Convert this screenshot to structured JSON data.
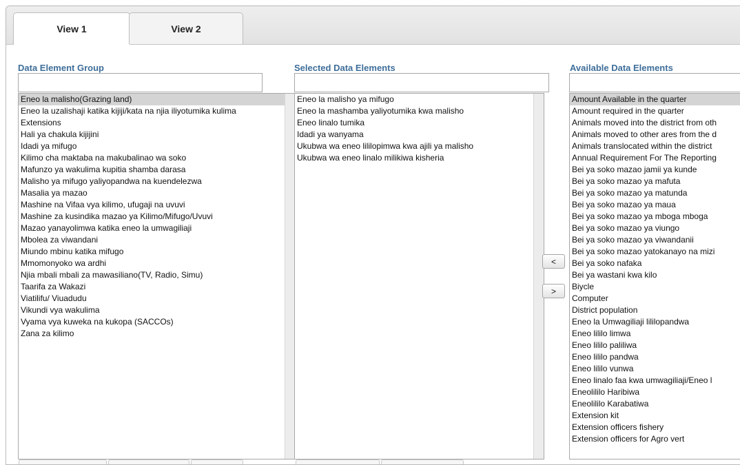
{
  "tabs": [
    {
      "label": "View 1",
      "active": true
    },
    {
      "label": "View 2",
      "active": false
    }
  ],
  "group": {
    "heading": "Data Element Group",
    "filter_value": "",
    "items": [
      "Eneo la malisho(Grazing land)",
      "Eneo la uzalishaji katika kijiji/kata na njia iliyotumika kulima",
      "Extensions",
      "Hali ya chakula kijijini",
      "Idadi ya mifugo",
      "Kilimo cha maktaba na makubalinao wa soko",
      "Mafunzo ya wakulima kupitia shamba darasa",
      "Malisho ya mifugo yaliyopandwa na kuendelezwa",
      "Masalia ya mazao",
      "Mashine na Vifaa vya kilimo, ufugaji na uvuvi",
      "Mashine za kusindika mazao ya Kilimo/Mifugo/Uvuvi",
      "Mazao yanayolimwa katika eneo la umwagiliaji",
      "Mbolea za viwandani",
      "Miundo mbinu katika mifugo",
      "Mmomonyoko wa ardhi",
      "Njia mbali mbali za mawasiliano(TV, Radio, Simu)",
      "Taarifa za Wakazi",
      "Viatilifu/ Viuadudu",
      "Vikundi vya wakulima",
      "Vyama vya kuweka na kukopa (SACCOs)",
      "Zana za kilimo"
    ],
    "selected_index": 0
  },
  "selected": {
    "heading": "Selected Data Elements",
    "filter_value": "",
    "items": [
      "Eneo la malisho ya mifugo",
      "Eneo la mashamba yaliyotumika kwa malisho",
      "Eneo linalo tumika",
      "Idadi ya wanyama",
      "Ukubwa wa eneo lililopimwa kwa ajili ya malisho",
      "Ukubwa wa eneo linalo milikiwa kisheria"
    ]
  },
  "available": {
    "heading": "Available Data Elements",
    "filter_value": "",
    "items": [
      "Amount Available in the quarter",
      "Amount required in the quarter",
      "Animals moved into the district from oth",
      "Animals moved to other ares from the d",
      "Animals translocated within the district",
      "Annual Requirement For The Reporting",
      "Bei ya soko mazao jamii ya kunde",
      "Bei ya soko mazao ya mafuta",
      "Bei ya soko mazao ya matunda",
      "Bei ya soko mazao ya maua",
      "Bei ya soko mazao ya mboga mboga",
      "Bei ya soko mazao ya viungo",
      "Bei ya soko mazao ya viwandanii",
      "Bei ya soko mazao yatokanayo na mizi",
      "Bei ya soko nafaka",
      "Bei ya wastani kwa kilo",
      "Biycle",
      "Computer",
      "District population",
      "Eneo la Umwagiliaji lililopandwa",
      "Eneo lililo limwa",
      "Eneo lililo paliliwa",
      "Eneo lililo pandwa",
      "Eneo lililo vunwa",
      "Eneo linalo faa kwa umwagiliaji/Eneo l",
      "Eneolililo Haribiwa",
      "Eneolililo Karabatiwa",
      "Extension kit",
      "Extension officers fishery",
      "Extension officers for Agro vert"
    ],
    "selected_index": 0
  },
  "buttons": {
    "remove_label": "<",
    "add_label": ">"
  },
  "colors": {
    "heading": "#3e6e9a",
    "selected_row": "#d4d4d4"
  }
}
